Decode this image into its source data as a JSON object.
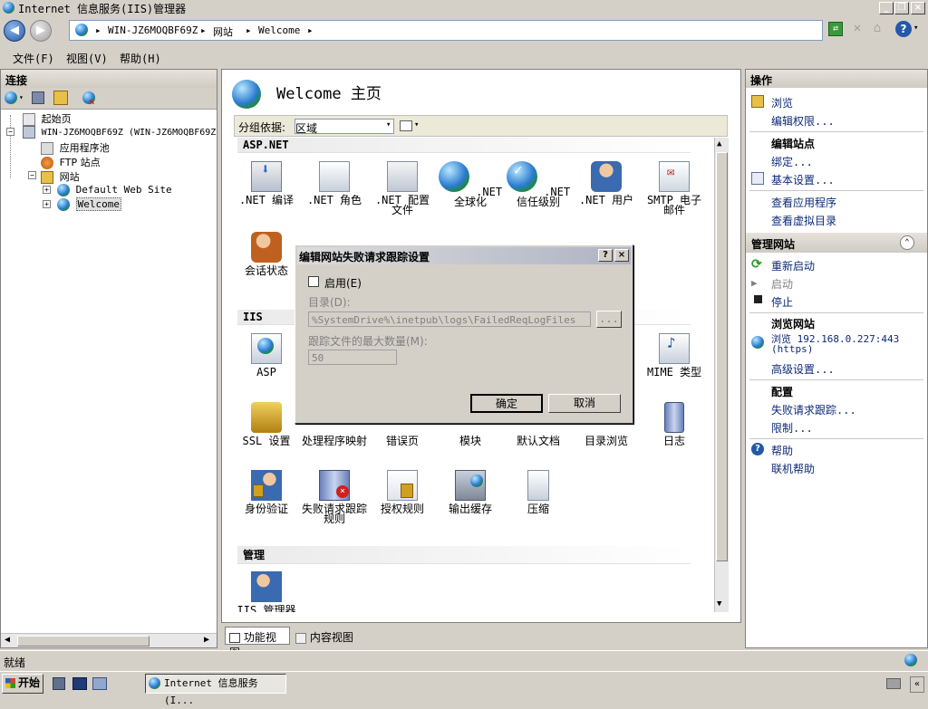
{
  "window": {
    "title": "Internet 信息服务(IIS)管理器"
  },
  "address": {
    "segments": [
      "WIN-JZ6MOQBF69Z",
      "网站",
      "Welcome"
    ]
  },
  "menu": [
    "文件(F)",
    "视图(V)",
    "帮助(H)"
  ],
  "connections": {
    "title": "连接",
    "tree": [
      {
        "label": "起始页",
        "level": 0
      },
      {
        "label": "WIN-JZ6MOQBF69Z (WIN-JZ6MOQBF69Z",
        "level": 0
      },
      {
        "label": "应用程序池",
        "level": 1
      },
      {
        "label": "FTP 站点",
        "level": 1
      },
      {
        "label": "网站",
        "level": 1
      },
      {
        "label": "Default Web Site",
        "level": 2
      },
      {
        "label": "Welcome",
        "level": 2
      }
    ]
  },
  "center": {
    "heading": "Welcome 主页",
    "group_label": "分组依据:",
    "group_value": "区域",
    "sections": {
      "aspnet": "ASP.NET",
      "iis": "IIS",
      "manage": "管理"
    },
    "aspnet_features": [
      ".NET 编译",
      ".NET 角色",
      ".NET 配置文件",
      ".NET 全球化",
      ".NET 信任级别",
      ".NET 用户",
      "SMTP 电子邮件",
      "会话状态"
    ],
    "iis_features_row1": [
      "ASP",
      "MIME 类型"
    ],
    "iis_features_row2": [
      "SSL 设置",
      "处理程序映射",
      "错误页",
      "模块",
      "默认文档",
      "目录浏览",
      "日志"
    ],
    "iis_features_row3": [
      "身份验证",
      "失败请求跟踪规则",
      "授权规则",
      "输出缓存",
      "压缩"
    ],
    "manage_features": [
      "IIS 管理器"
    ],
    "view_tabs": [
      "功能视图",
      "内容视图"
    ]
  },
  "actions": {
    "title": "操作",
    "items": {
      "browse": "浏览",
      "edit_perm": "编辑权限...",
      "edit_site": "编辑站点",
      "bindings": "绑定...",
      "basic": "基本设置...",
      "view_apps": "查看应用程序",
      "view_vdirs": "查看虚拟目录",
      "manage_site": "管理网站",
      "restart": "重新启动",
      "start": "启动",
      "stop": "停止",
      "browse_site": "浏览网站",
      "browse_addr": "浏览 192.168.0.227:443",
      "browse_proto": "(https)",
      "advanced": "高级设置...",
      "config": "配置",
      "failed_req": "失败请求跟踪...",
      "limits": "限制...",
      "help": "帮助",
      "online_help": "联机帮助"
    }
  },
  "dialog": {
    "title": "编辑网站失败请求跟踪设置",
    "help": "?",
    "close": "×",
    "enable_label": "启用(E)",
    "enabled": false,
    "dir_label": "目录(D):",
    "dir_value": "%SystemDrive%\\inetpub\\logs\\FailedReqLogFiles",
    "browse_btn": "...",
    "max_label": "跟踪文件的最大数量(M):",
    "max_value": "50",
    "ok": "确定",
    "cancel": "取消"
  },
  "status": {
    "text": "就绪"
  },
  "taskbar": {
    "start": "开始",
    "task": "Internet 信息服务(I..."
  }
}
